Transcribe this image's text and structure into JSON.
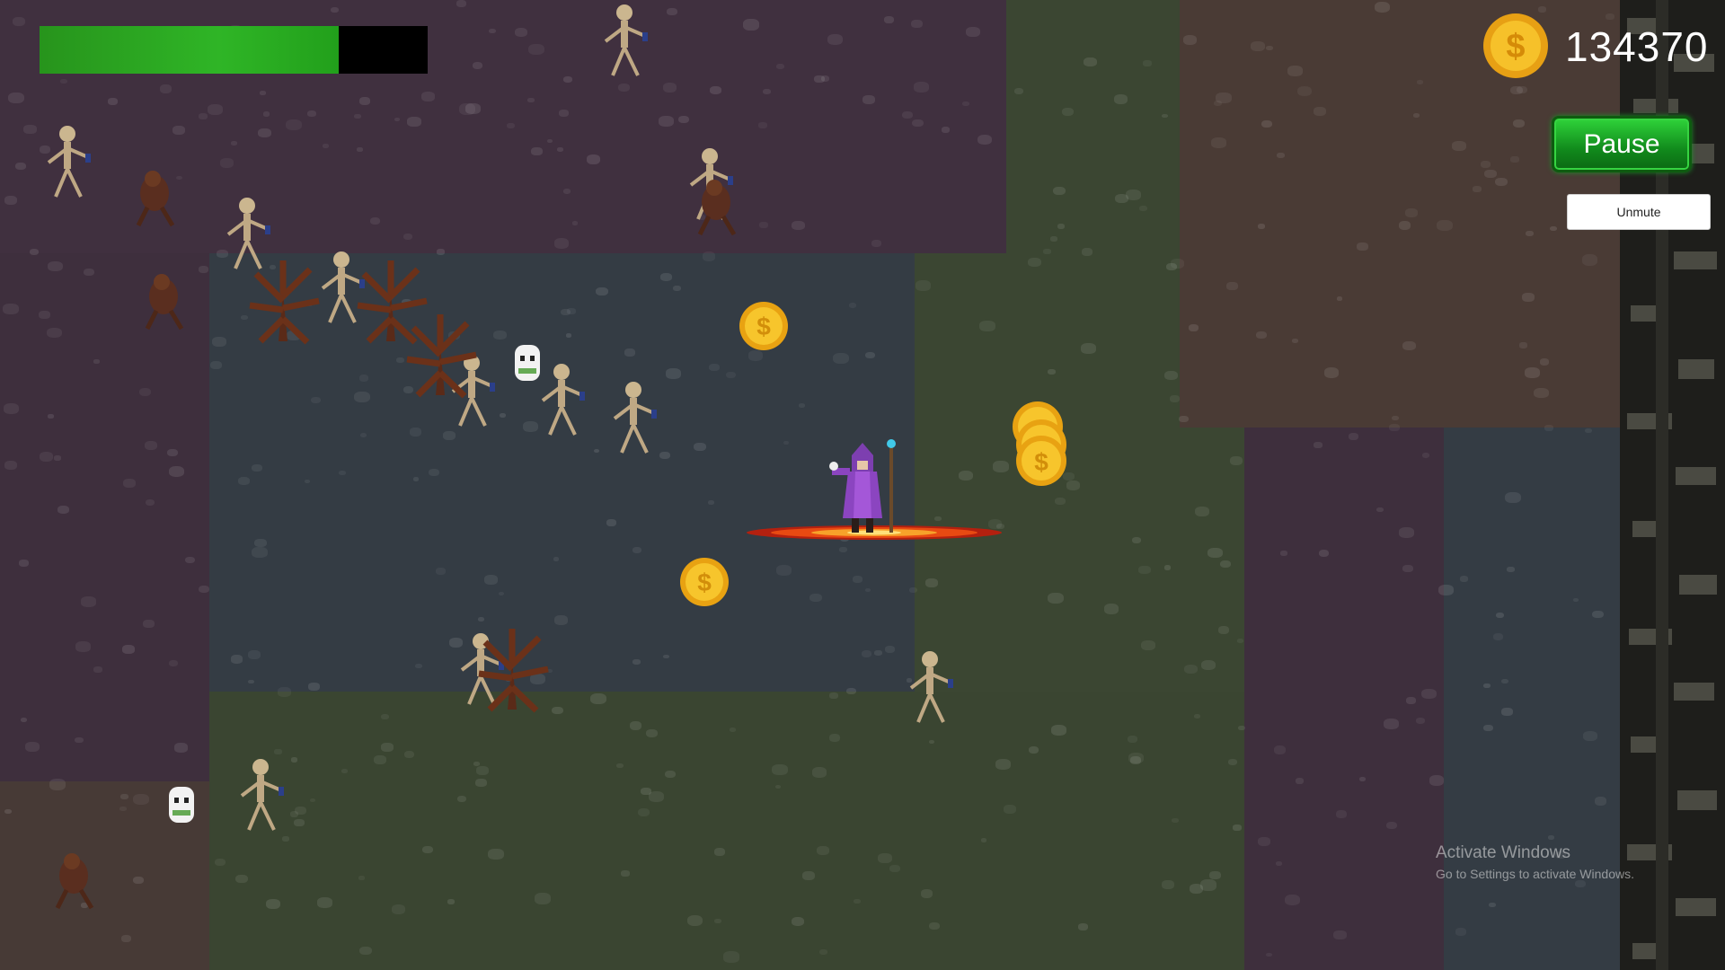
{
  "hud": {
    "health_fraction": 0.77,
    "coin_icon": "gold-coin-icon",
    "coin_count": "134370",
    "pause_label": "Pause",
    "unmute_label": "Unmute"
  },
  "colors": {
    "health_fill": "#2fb526",
    "health_empty": "#000000",
    "pause_button": "#1a9b26",
    "coin_gold": "#f2b51c"
  },
  "world": {
    "player": "wizard-player",
    "effect": "fire-ring",
    "coins_on_ground": 5
  },
  "watermark": {
    "title": "Activate Windows",
    "subtitle": "Go to Settings to activate Windows."
  }
}
